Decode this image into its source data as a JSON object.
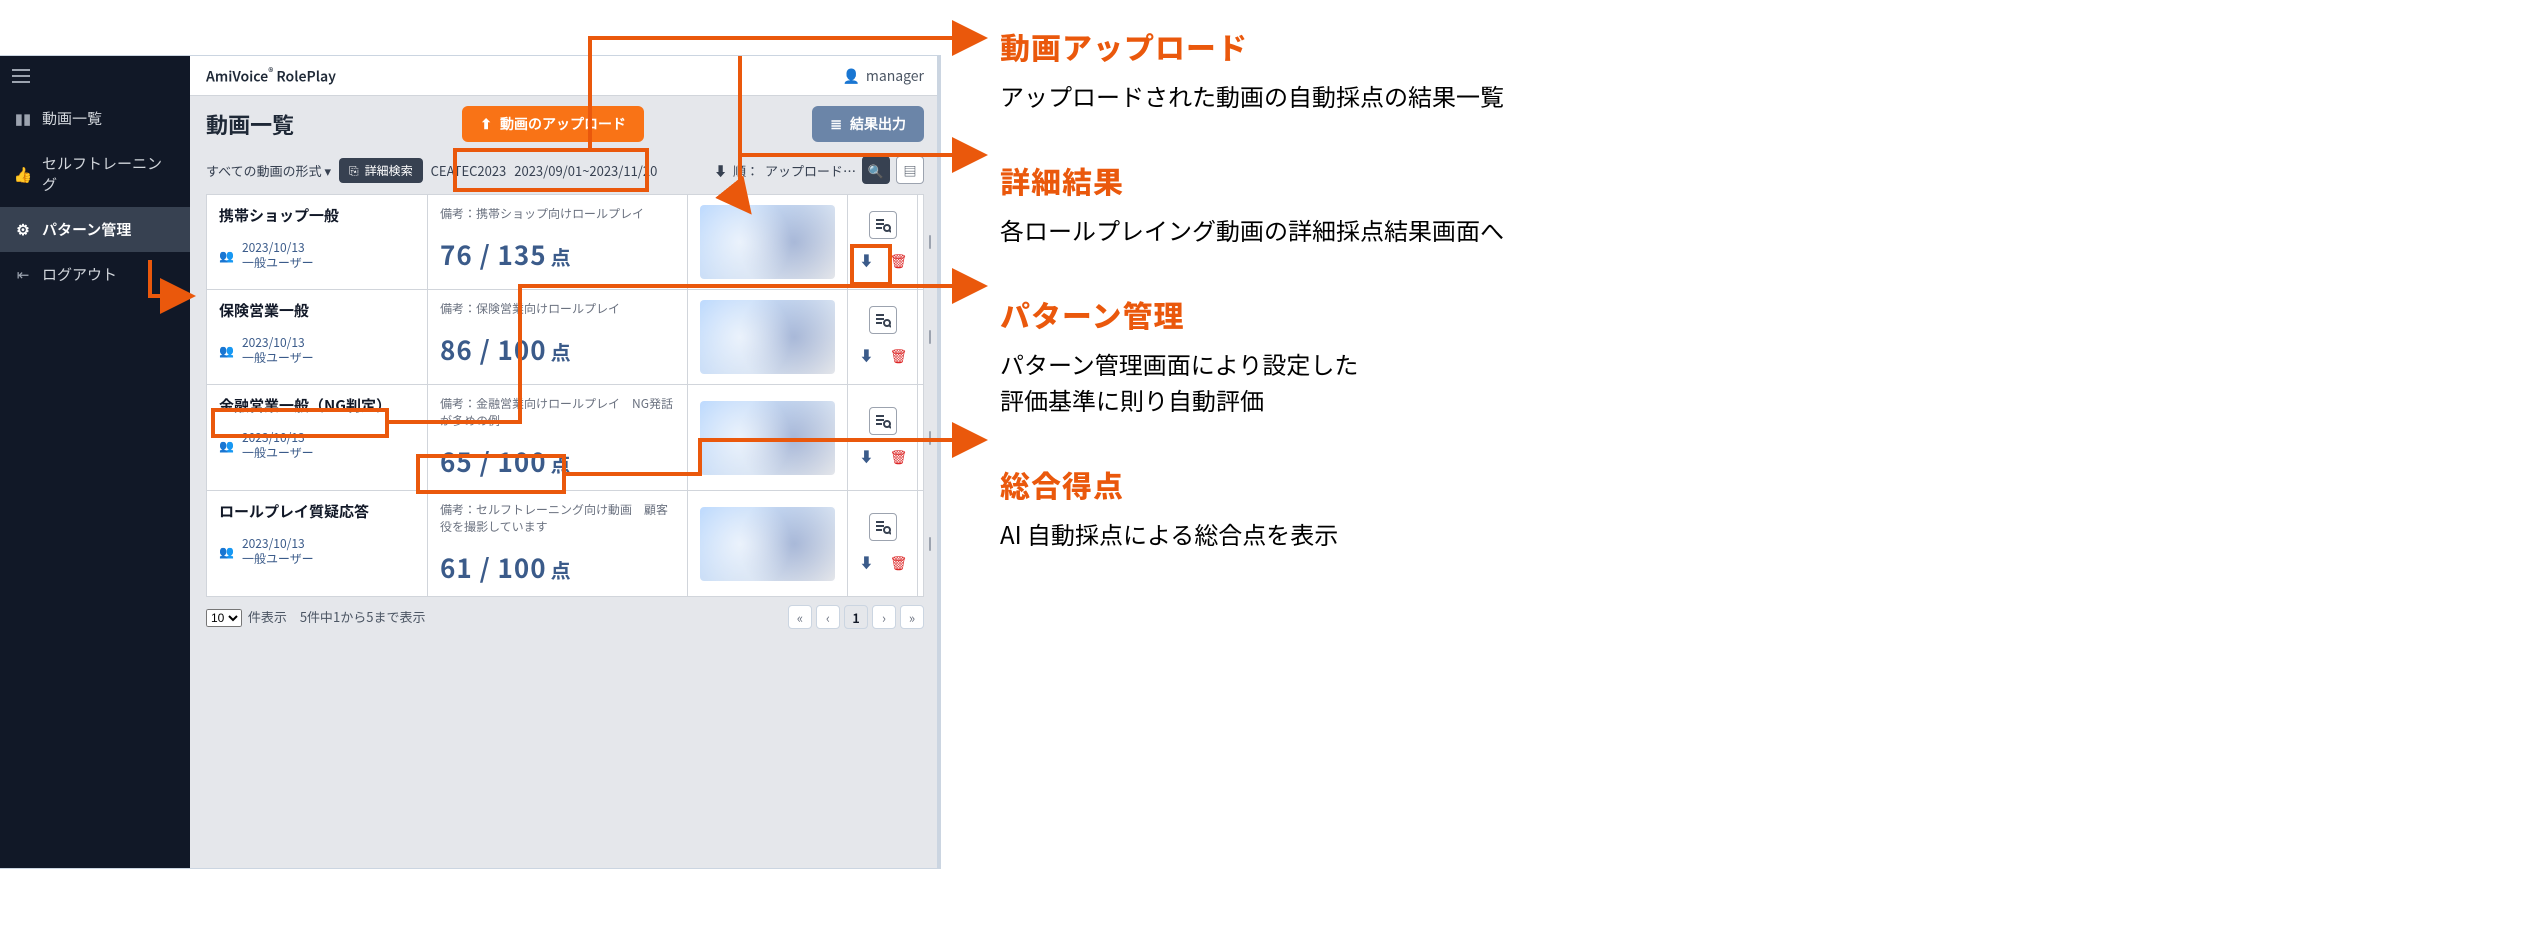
{
  "app": {
    "title_brand": "AmiVoice",
    "title_product": "RolePlay",
    "user_label": "manager"
  },
  "sidebar": {
    "items": [
      {
        "label": "動画一覧",
        "icon": "chart-icon",
        "active": false
      },
      {
        "label": "セルフトレーニング",
        "icon": "thumbs-up-icon",
        "active": false
      },
      {
        "label": "パターン管理",
        "icon": "gear-icon",
        "active": true
      },
      {
        "label": "ログアウト",
        "icon": "logout-icon",
        "active": false
      }
    ]
  },
  "header": {
    "page_title": "動画一覧",
    "upload_label": "動画のアップロード",
    "export_label": "結果出力"
  },
  "filter": {
    "scope_label": "すべての動画の形式",
    "advanced_label": "詳細検索",
    "tag": "CEATEC2023",
    "date_range": "2023/09/01~2023/11/20",
    "sort_prefix": "順：",
    "sort_value": "アップロード…"
  },
  "rows": [
    {
      "title": "携帯ショップ一般",
      "date": "2023/10/13",
      "user": "一般ユーザー",
      "note_label": "備考：",
      "note": "携帯ショップ向けロールプレイ",
      "score": "76 / 135",
      "score_unit": "点"
    },
    {
      "title": "保険営業一般",
      "date": "2023/10/13",
      "user": "一般ユーザー",
      "note_label": "備考：",
      "note": "保険営業向けロールプレイ",
      "score": "86 / 100",
      "score_unit": "点"
    },
    {
      "title": "金融営業一般（NG判定）",
      "date": "2023/10/13",
      "user": "一般ユーザー",
      "note_label": "備考：",
      "note": "金融営業向けロールプレイ　NG発話が多めの例",
      "score": "65 / 100",
      "score_unit": "点"
    },
    {
      "title": "ロールプレイ質疑応答",
      "date": "2023/10/13",
      "user": "一般ユーザー",
      "note_label": "備考：",
      "note": "セルフトレーニング向け動画　顧客役を撮影しています",
      "score": "61 / 100",
      "score_unit": "点"
    }
  ],
  "pager": {
    "page_size": "10",
    "summary": "件表示　5件中1から5まで表示",
    "current": "1"
  },
  "annotations": [
    {
      "title": "動画アップロード",
      "body": "アップロードされた動画の自動採点の結果一覧"
    },
    {
      "title": "詳細結果",
      "body": "各ロールプレイング動画の詳細採点結果画面へ"
    },
    {
      "title": "パターン管理",
      "body": "パターン管理画面により設定した\n評価基準に則り自動評価"
    },
    {
      "title": "総合得点",
      "body": "AI 自動採点による総合点を表示"
    }
  ]
}
